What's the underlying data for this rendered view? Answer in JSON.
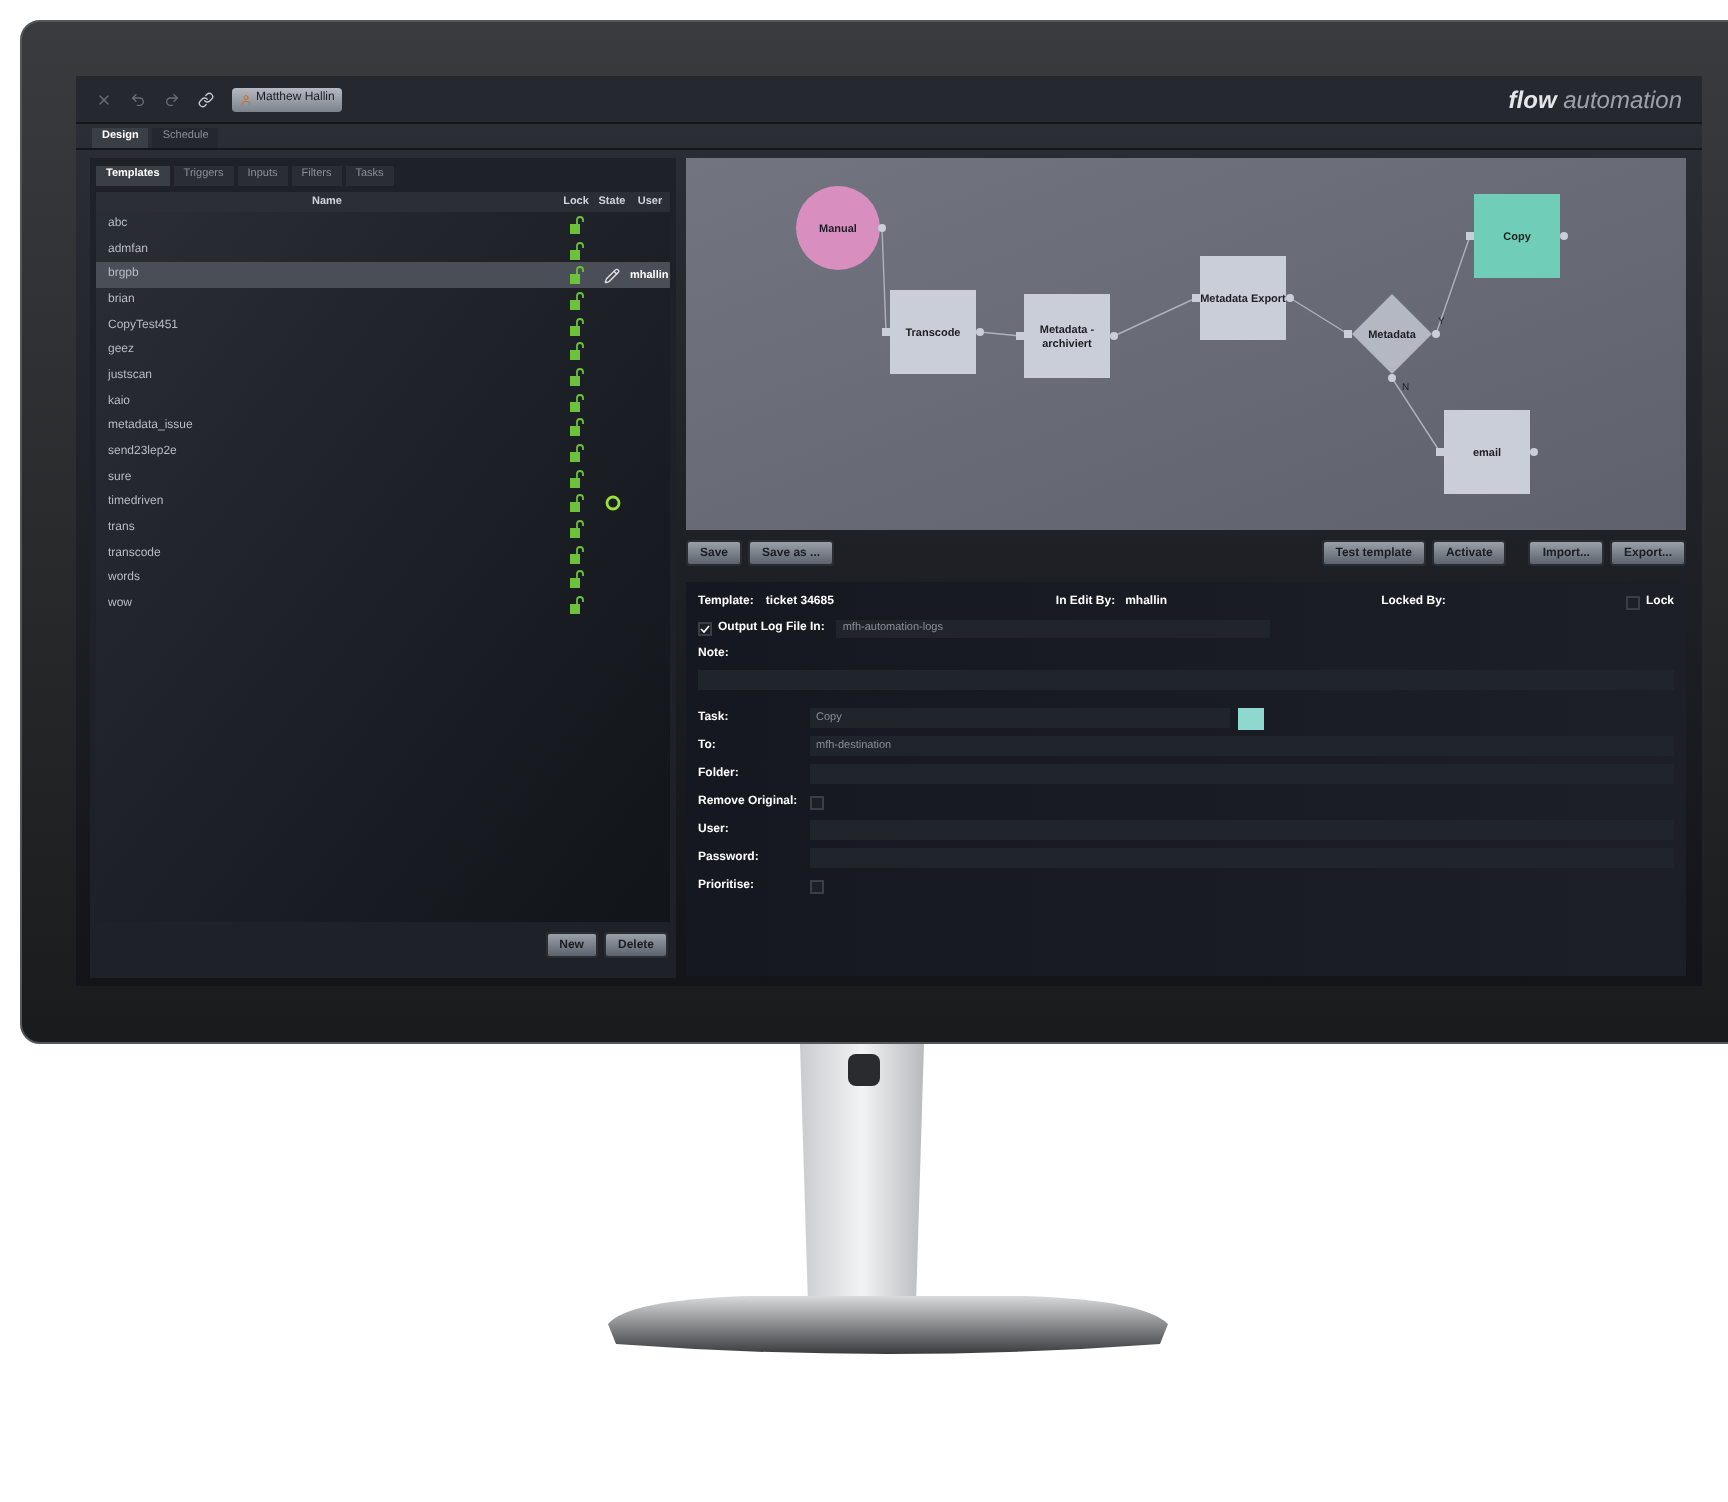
{
  "toolbar": {
    "user": "Matthew Hallin",
    "logo": {
      "strong": "flow",
      "light": "automation"
    }
  },
  "main_tabs": [
    {
      "label": "Design",
      "selected": true
    },
    {
      "label": "Schedule",
      "selected": false
    }
  ],
  "left_panel": {
    "tabs": [
      {
        "label": "Templates",
        "selected": true
      },
      {
        "label": "Triggers",
        "selected": false
      },
      {
        "label": "Inputs",
        "selected": false
      },
      {
        "label": "Filters",
        "selected": false
      },
      {
        "label": "Tasks",
        "selected": false
      }
    ],
    "columns": [
      "Name",
      "Lock",
      "State",
      "User"
    ],
    "rows": [
      {
        "name": "abc",
        "locked": false,
        "editing": false,
        "scheduled": false,
        "selected": false
      },
      {
        "name": "admfan",
        "locked": false,
        "editing": false,
        "scheduled": false,
        "selected": false
      },
      {
        "name": "brgpb",
        "locked": false,
        "editing": true,
        "scheduled": false,
        "user": "mhallin",
        "selected": true
      },
      {
        "name": "brian",
        "locked": false,
        "editing": false,
        "scheduled": false,
        "selected": false
      },
      {
        "name": "CopyTest451",
        "locked": false,
        "editing": false,
        "scheduled": false,
        "selected": false
      },
      {
        "name": "geez",
        "locked": false,
        "editing": false,
        "scheduled": false,
        "selected": false
      },
      {
        "name": "justscan",
        "locked": false,
        "editing": false,
        "scheduled": false,
        "selected": false
      },
      {
        "name": "kaio",
        "locked": false,
        "editing": false,
        "scheduled": false,
        "selected": false
      },
      {
        "name": "metadata_issue",
        "locked": false,
        "editing": false,
        "scheduled": false,
        "selected": false
      },
      {
        "name": "send23lep2e",
        "locked": false,
        "editing": false,
        "scheduled": false,
        "selected": false
      },
      {
        "name": "sure",
        "locked": false,
        "editing": false,
        "scheduled": false,
        "selected": false
      },
      {
        "name": "timedriven",
        "locked": false,
        "editing": false,
        "scheduled": true,
        "selected": false
      },
      {
        "name": "trans",
        "locked": false,
        "editing": false,
        "scheduled": false,
        "selected": false
      },
      {
        "name": "transcode",
        "locked": false,
        "editing": false,
        "scheduled": false,
        "selected": false
      },
      {
        "name": "words",
        "locked": false,
        "editing": false,
        "scheduled": false,
        "selected": false
      },
      {
        "name": "wow",
        "locked": false,
        "editing": false,
        "scheduled": false,
        "selected": false
      }
    ],
    "buttons": [
      "New",
      "Delete"
    ]
  },
  "diagram": {
    "nodes": [
      {
        "kind": "start",
        "label": "Manual",
        "color": "#d98ec0"
      },
      {
        "kind": "task",
        "label": "Transcode",
        "color": "#c9ced8"
      },
      {
        "kind": "task",
        "label": "Metadata - archiviert",
        "color": "#c9ced8"
      },
      {
        "kind": "task",
        "label": "Metadata Export",
        "color": "#c9ced8"
      },
      {
        "kind": "decision",
        "label": "Metadata",
        "color": "#b3b8c2",
        "yes_label": "Y",
        "no_label": "N"
      },
      {
        "kind": "task",
        "label": "Copy",
        "color": "#6fcdb8"
      },
      {
        "kind": "task",
        "label": "email",
        "color": "#c9ced8"
      }
    ]
  },
  "actions": {
    "left": [
      "Save",
      "Save as ..."
    ],
    "right": [
      "Test template",
      "Activate",
      "Import...",
      "Export..."
    ]
  },
  "form": {
    "template_label": "Template:",
    "template": "ticket 34685",
    "edit_label": "In Edit By:",
    "edit_by": "mhallin",
    "locked_label": "Locked By:",
    "lock": {
      "label": "Lock",
      "checked": false
    },
    "output_log": {
      "label": "Output Log File In:",
      "checked": true,
      "value": "mfh-automation-logs"
    },
    "note_label": "Note:",
    "fields": [
      {
        "kind": "task",
        "label": "Task:",
        "value": "Copy",
        "color": "#8fd8d0"
      },
      {
        "kind": "text",
        "label": "To:",
        "value": "mfh-destination"
      },
      {
        "kind": "text",
        "label": "Folder:"
      },
      {
        "kind": "checkbox",
        "label": "Remove Original:",
        "checked": false
      },
      {
        "kind": "text",
        "label": "User:"
      },
      {
        "kind": "text",
        "label": "Password:"
      },
      {
        "kind": "checkbox",
        "label": "Prioritise:",
        "checked": false
      }
    ]
  }
}
